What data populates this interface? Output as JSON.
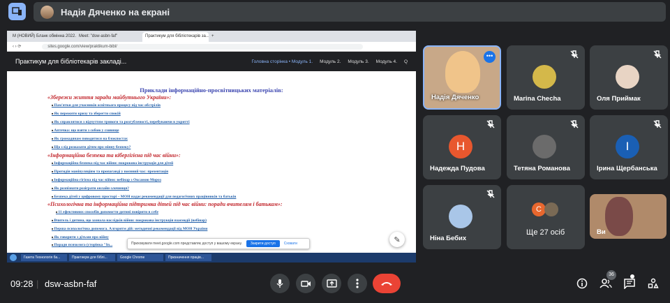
{
  "presenter": {
    "label": "Надія Дяченко на екрані"
  },
  "browser": {
    "tabs": [
      "M (НОВИЙ) Бланк обмінна 2022...",
      "Meet: \"dsw-asbn-faf\"",
      "Практикум для бібліотекарів за...",
      "+"
    ],
    "url": "sites.google.com/view/praktikum-bibl/"
  },
  "site": {
    "title": "Практикум для бібліотекарів закладі...",
    "nav": [
      "Головна сторінка • Модуль 1.",
      "Модуль 2.",
      "Модуль 3.",
      "Модуль 4.",
      "Q"
    ]
  },
  "document": {
    "heading": "Приклади інформаційно-просвітницьких матеріалів:",
    "sections": [
      {
        "title": "«Збережи життя заради майбутнього України»:",
        "items": [
          "Пам'ятки для учасників освітнього процесу під час обстрілів",
          "Як пережити кризу та зберегти спокій",
          "Як справлятися з відчуттям тривоги та розгубленості, перебуваючи в укритті",
          "Аптечка: що взяти з собою у сховище",
          "Як громадянам поводитися на блокпостах",
          "Що слід розказати дітям про мінну безпеку?"
        ]
      },
      {
        "title": "«Інформаційна безпека та кібергігієна під час війни»:",
        "items": [
          "Інформаційна безпека під час війни: покрокова інструкція для дітей",
          "Протидія маніпуляціям та пропаганді у воєнний час: презентація",
          "Інформаційна гігієна під час війни: вебінар з Оксаною Мороз",
          "Як розпізнати розіграти онлайн-злочинця?",
          "Безпека дітей у цифровому просторі – МОН надає рекомендації для педагогічних працівників та батьків"
        ]
      },
      {
        "title": "«Психологічна та інформаційна підтримка дітей під час війни: поради вчителям і батькам»:",
        "items": [
          "11 ефективних способів допомогти дитині повірити в себе",
          "Вчитель і дитина, що зазнала наслідків війни: покрокова інструкція взаємодії (вебінар)",
          "Перша психологічна допомога. Алгоритм дій: методичні рекомендації від МОН України",
          "Як говорити з дітьми про війну",
          "Поради психолога (сторінка \"Іп..."
        ]
      }
    ]
  },
  "toast": {
    "text": "Приховувати meet.google.com представляє доступ у вашому екрану.",
    "primary": "Закрити доступ",
    "secondary": "Сховати"
  },
  "taskbar": [
    "Газета Технологія ба...",
    "Практикум для біблі...",
    "Google Chrome",
    "Призначення праців..."
  ],
  "participants": [
    {
      "name": "Надія Дяченко",
      "type": "photo"
    },
    {
      "name": "Marina Checha",
      "type": "avatar",
      "initial": "",
      "color": "#d4b84a"
    },
    {
      "name": "Оля Приймак",
      "type": "avatar",
      "initial": "",
      "color": "#e8d4c4"
    },
    {
      "name": "Надежда Пудова",
      "type": "letter",
      "initial": "Н",
      "color": "#e8572e"
    },
    {
      "name": "Тетяна Романова",
      "type": "avatar",
      "initial": "",
      "color": "#6b6b6b"
    },
    {
      "name": "Ірина Щербанська",
      "type": "letter",
      "initial": "І",
      "color": "#1a5fb4"
    },
    {
      "name": "Ніна Бебих",
      "type": "avatar",
      "initial": "",
      "color": "#a9c6e8"
    },
    {
      "name": "Ще 27 осіб",
      "type": "more",
      "initial": "С",
      "color": "#e8672e"
    },
    {
      "name": "Ви",
      "type": "self"
    }
  ],
  "bottom": {
    "time": "09:28",
    "code": "dsw-asbn-faf",
    "people_count": "36"
  },
  "colors": {
    "bg": "#202124",
    "tile": "#3c4043",
    "end": "#ea4335",
    "accent": "#8ab4f8"
  },
  "icons": [
    "screen-share-icon",
    "mic-off-icon",
    "more-icon",
    "mic-icon",
    "camera-icon",
    "present-icon",
    "hangup-icon",
    "info-icon",
    "people-icon",
    "chat-icon",
    "activities-icon",
    "pencil-icon",
    "windows-icon"
  ]
}
